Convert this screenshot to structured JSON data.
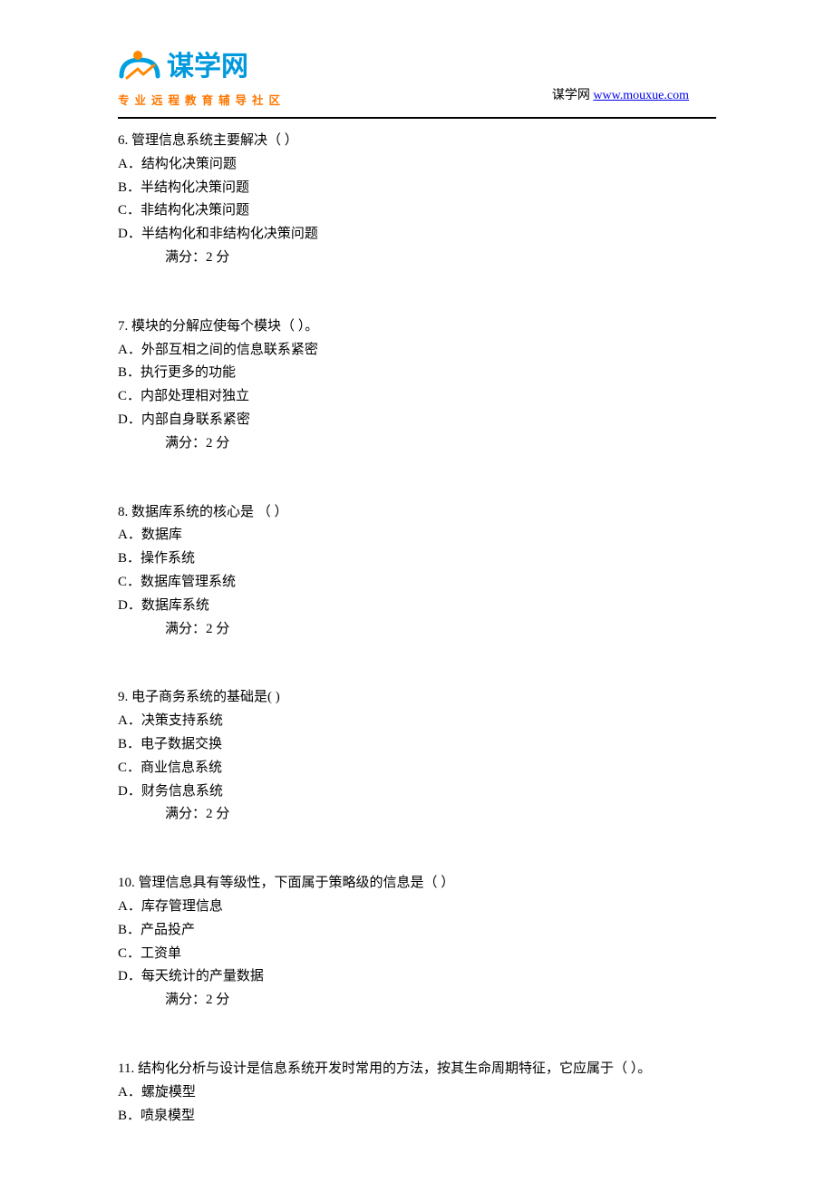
{
  "header": {
    "logo_cn": "谋学网",
    "logo_url_small": "www.mouxue.com",
    "tagline": "专业远程教育辅导社区",
    "right_prefix": "谋学网 ",
    "right_link": "www.mouxue.com"
  },
  "questions": [
    {
      "num": "6.",
      "stem": "管理信息系统主要解决（ ）",
      "options": [
        "A．结构化决策问题",
        "B．半结构化决策问题",
        "C．非结构化决策问题",
        "D．半结构化和非结构化决策问题"
      ],
      "score": "满分：2  分"
    },
    {
      "num": "7.",
      "stem": "模块的分解应使每个模块（ ）。",
      "options": [
        "A．外部互相之间的信息联系紧密",
        "B．执行更多的功能",
        "C．内部处理相对独立",
        "D．内部自身联系紧密"
      ],
      "score": "满分：2  分"
    },
    {
      "num": "8.",
      "stem": "数据库系统的核心是 （ ）",
      "options": [
        "A．数据库",
        "B．操作系统",
        "C．数据库管理系统",
        "D．数据库系统"
      ],
      "score": "满分：2  分"
    },
    {
      "num": "9.",
      "stem": "电子商务系统的基础是( )",
      "options": [
        "A．决策支持系统",
        "B．电子数据交换",
        "C．商业信息系统",
        "D．财务信息系统"
      ],
      "score": "满分：2  分"
    },
    {
      "num": "10.",
      "stem": "管理信息具有等级性，下面属于策略级的信息是（ ）",
      "options": [
        "A．库存管理信息",
        "B．产品投产",
        "C．工资单",
        "D．每天统计的产量数据"
      ],
      "score": "满分：2  分"
    },
    {
      "num": "11.",
      "stem": "结构化分析与设计是信息系统开发时常用的方法，按其生命周期特征，它应属于（ ）。",
      "options": [
        "A．螺旋模型",
        "B．喷泉模型"
      ],
      "score": ""
    }
  ]
}
